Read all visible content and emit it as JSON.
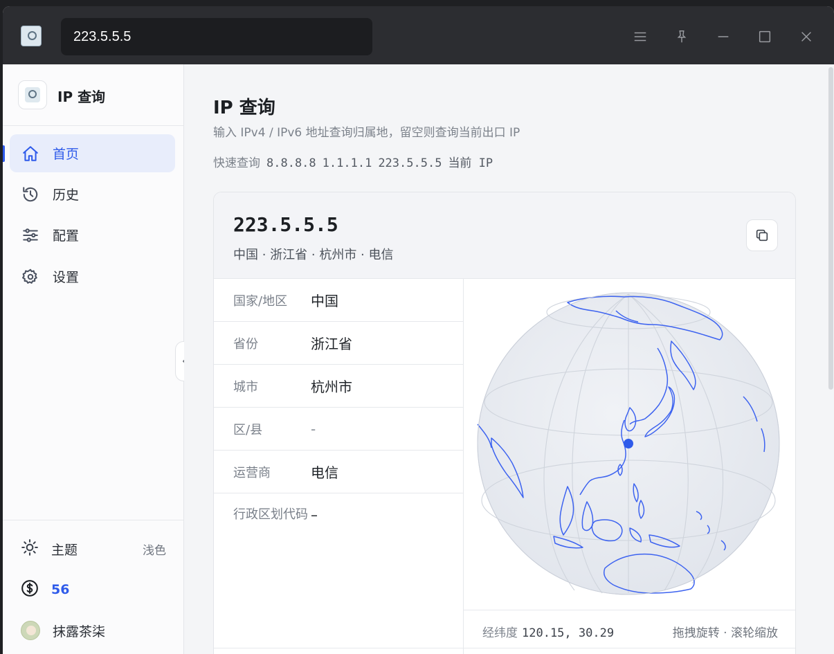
{
  "titlebar": {
    "search_value": "223.5.5.5",
    "buttons": [
      "menu-icon",
      "pin-icon",
      "minimize-icon",
      "maximize-icon",
      "close-icon"
    ]
  },
  "sidebar": {
    "brand": "IP 查询",
    "items": [
      {
        "label": "首页",
        "icon": "home-icon",
        "active": true
      },
      {
        "label": "历史",
        "icon": "history-icon",
        "active": false
      },
      {
        "label": "配置",
        "icon": "sliders-icon",
        "active": false
      },
      {
        "label": "设置",
        "icon": "gear-icon",
        "active": false
      }
    ],
    "footer": {
      "theme_label": "主题",
      "theme_value": "浅色",
      "credits": "56",
      "username": "抹露茶柒"
    }
  },
  "main": {
    "title": "IP 查询",
    "subtitle": "输入 IPv4 / IPv6 地址查询归属地，留空则查询当前出口 IP",
    "quick_label": "快速查询",
    "quick_items": [
      "8.8.8.8",
      "1.1.1.1",
      "223.5.5.5",
      "当前 IP"
    ],
    "result": {
      "ip": "223.5.5.5",
      "location": "中国 · 浙江省 · 杭州市 · 电信",
      "rows": [
        {
          "key": "国家/地区",
          "value": "中国"
        },
        {
          "key": "省份",
          "value": "浙江省"
        },
        {
          "key": "城市",
          "value": "杭州市"
        },
        {
          "key": "区/县",
          "value": "-"
        },
        {
          "key": "运营商",
          "value": "电信"
        },
        {
          "key": "行政区划代码",
          "value": "–"
        }
      ],
      "coords_label": "经纬度",
      "coords_value": "120.15, 30.29",
      "map_hint": "拖拽旋转 · 滚轮缩放"
    },
    "colors": {
      "accent": "#2f5bea",
      "land_stroke": "#3d63f0",
      "globe_fill": "#e8ebf1"
    }
  }
}
